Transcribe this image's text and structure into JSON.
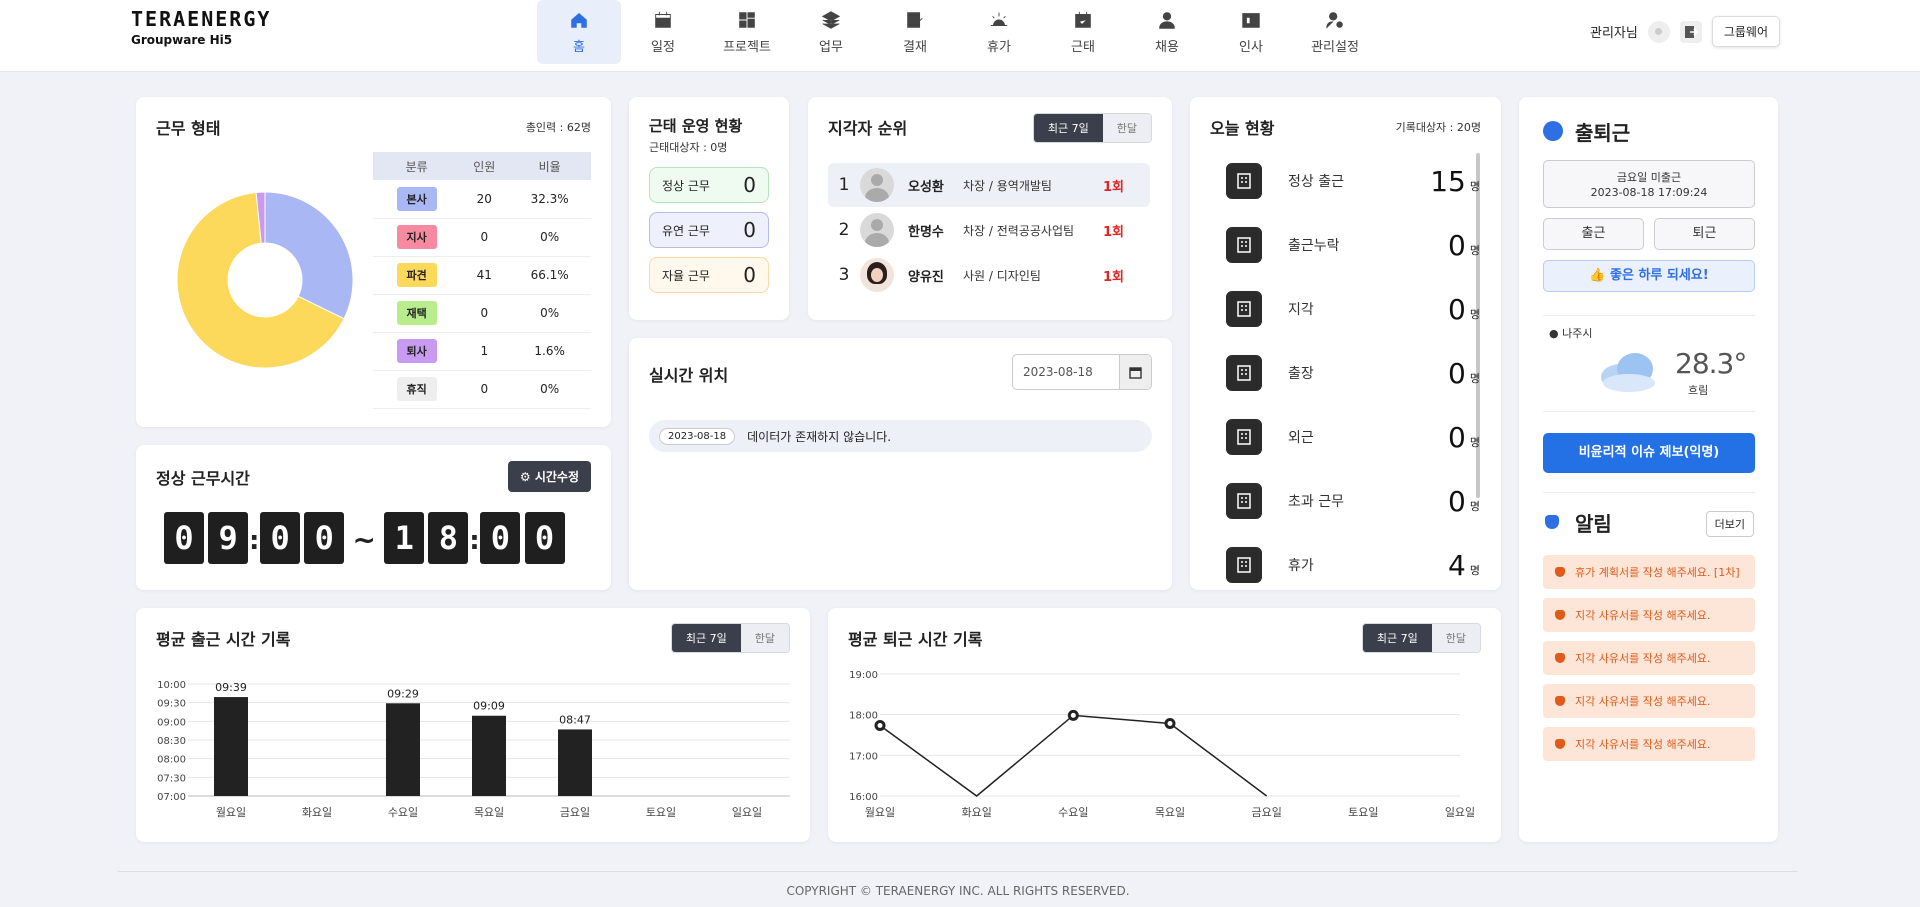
{
  "header": {
    "brand": "TERAENERGY",
    "subbrand": "Groupware Hi5",
    "nav": [
      {
        "label": "홈",
        "icon": "home-icon",
        "active": true
      },
      {
        "label": "일정",
        "icon": "calendar-icon"
      },
      {
        "label": "프로젝트",
        "icon": "grid-icon"
      },
      {
        "label": "업무",
        "icon": "layers-icon"
      },
      {
        "label": "결재",
        "icon": "edit-icon"
      },
      {
        "label": "휴가",
        "icon": "sunrise-icon"
      },
      {
        "label": "근태",
        "icon": "calendar-check-icon"
      },
      {
        "label": "채용",
        "icon": "user-icon"
      },
      {
        "label": "인사",
        "icon": "id-card-icon"
      },
      {
        "label": "관리설정",
        "icon": "user-gear-icon"
      }
    ],
    "admin": "관리자님",
    "groupware_btn": "그룹웨어"
  },
  "work_type": {
    "title": "근무 형태",
    "total": "총인력 : 62명",
    "columns": [
      "분류",
      "인원",
      "비율"
    ],
    "rows": [
      {
        "cat": "본사",
        "count": "20",
        "ratio": "32.3%",
        "color": "#a9b7f5"
      },
      {
        "cat": "지사",
        "count": "0",
        "ratio": "0%",
        "color": "#f78aa0"
      },
      {
        "cat": "파견",
        "count": "41",
        "ratio": "66.1%",
        "color": "#fcd95a"
      },
      {
        "cat": "재택",
        "count": "0",
        "ratio": "0%",
        "color": "#b9ec8c"
      },
      {
        "cat": "퇴사",
        "count": "1",
        "ratio": "1.6%",
        "color": "#c89af2"
      },
      {
        "cat": "휴직",
        "count": "0",
        "ratio": "0%",
        "color": "#eeeeee"
      }
    ]
  },
  "work_hours": {
    "title": "정상 근무시간",
    "edit_btn": "시간수정",
    "start": [
      "0",
      "9",
      "0",
      "0"
    ],
    "end": [
      "1",
      "8",
      "0",
      "0"
    ]
  },
  "attendance_ops": {
    "title": "근태 운영 현황",
    "subtitle": "근태대상자 : 0명",
    "items": [
      {
        "label": "정상 근무",
        "value": "0",
        "bg": "#effaf0",
        "border": "#b8e2bd"
      },
      {
        "label": "유연 근무",
        "value": "0",
        "bg": "#eef1fb",
        "border": "#b3bde8"
      },
      {
        "label": "자율 근무",
        "value": "0",
        "bg": "#fff8ec",
        "border": "#f5d9a6"
      }
    ]
  },
  "late_rank": {
    "title": "지각자 순위",
    "tabs": [
      "최근 7일",
      "한달"
    ],
    "rows": [
      {
        "rank": "1",
        "name": "오성환",
        "pos": "차장 / 용역개발팀",
        "count": "1회"
      },
      {
        "rank": "2",
        "name": "한명수",
        "pos": "차장 / 전력공공사업팀",
        "count": "1회"
      },
      {
        "rank": "3",
        "name": "양유진",
        "pos": "사원 / 디자인팀",
        "count": "1회"
      }
    ]
  },
  "realtime": {
    "title": "실시간 위치",
    "date": "2023-08-18",
    "chip": "2023-08-18",
    "empty": "데이터가 존재하지 않습니다."
  },
  "today": {
    "title": "오늘 현황",
    "target": "기록대상자 : 20명",
    "unit": "명",
    "rows": [
      {
        "label": "정상 출근",
        "value": "15"
      },
      {
        "label": "출근누락",
        "value": "0"
      },
      {
        "label": "지각",
        "value": "0"
      },
      {
        "label": "출장",
        "value": "0"
      },
      {
        "label": "외근",
        "value": "0"
      },
      {
        "label": "초과 근무",
        "value": "0"
      },
      {
        "label": "휴가",
        "value": "4"
      }
    ]
  },
  "commute": {
    "title": "출퇴근",
    "status": "금요일 미출근",
    "datetime": "2023-08-18 17:09:24",
    "in_btn": "출근",
    "out_btn": "퇴근",
    "greeting": "👍 좋은 하루 되세요!",
    "location": "나주시",
    "temp": "28.3°",
    "weather": "흐림",
    "report_btn": "비윤리적 이슈 제보(익명)",
    "alarm_title": "알림",
    "more_btn": "더보기",
    "alerts": [
      "휴가 계획서를 작성 해주세요. [1차]",
      "지각 사유서를 작성 해주세요.",
      "지각 사유서를 작성 해주세요.",
      "지각 사유서를 작성 해주세요.",
      "지각 사유서를 작성 해주세요."
    ]
  },
  "avg_in": {
    "title": "평균 출근 시간 기록",
    "tabs": [
      "최근 7일",
      "한달"
    ]
  },
  "avg_out": {
    "title": "평균 퇴근 시간 기록",
    "tabs": [
      "최근 7일",
      "한달"
    ]
  },
  "chart_data": [
    {
      "type": "pie",
      "categories": [
        "본사",
        "지사",
        "파견",
        "재택",
        "퇴사",
        "휴직"
      ],
      "values": [
        20,
        0,
        41,
        0,
        1,
        0
      ]
    },
    {
      "type": "bar",
      "title": "평균 출근 시간 기록",
      "categories": [
        "월요일",
        "화요일",
        "수요일",
        "목요일",
        "금요일",
        "토요일",
        "일요일"
      ],
      "values": [
        579,
        null,
        569,
        549,
        527,
        null,
        null
      ],
      "labels": [
        "09:39",
        "",
        "09:29",
        "09:09",
        "08:47",
        "",
        ""
      ],
      "ylim": [
        420,
        600
      ],
      "yticks": [
        "07:00",
        "07:30",
        "08:00",
        "08:30",
        "09:00",
        "09:30",
        "10:00"
      ]
    },
    {
      "type": "line",
      "title": "평균 퇴근 시간 기록",
      "categories": [
        "월요일",
        "화요일",
        "수요일",
        "목요일",
        "금요일",
        "토요일",
        "일요일"
      ],
      "values": [
        1064,
        960,
        1079,
        1067,
        960,
        null,
        null
      ],
      "ylim": [
        960,
        1140
      ],
      "yticks": [
        "16:00",
        "17:00",
        "18:00",
        "19:00"
      ]
    }
  ],
  "footer": "COPYRIGHT © TERAENERGY INC. ALL RIGHTS RESERVED."
}
